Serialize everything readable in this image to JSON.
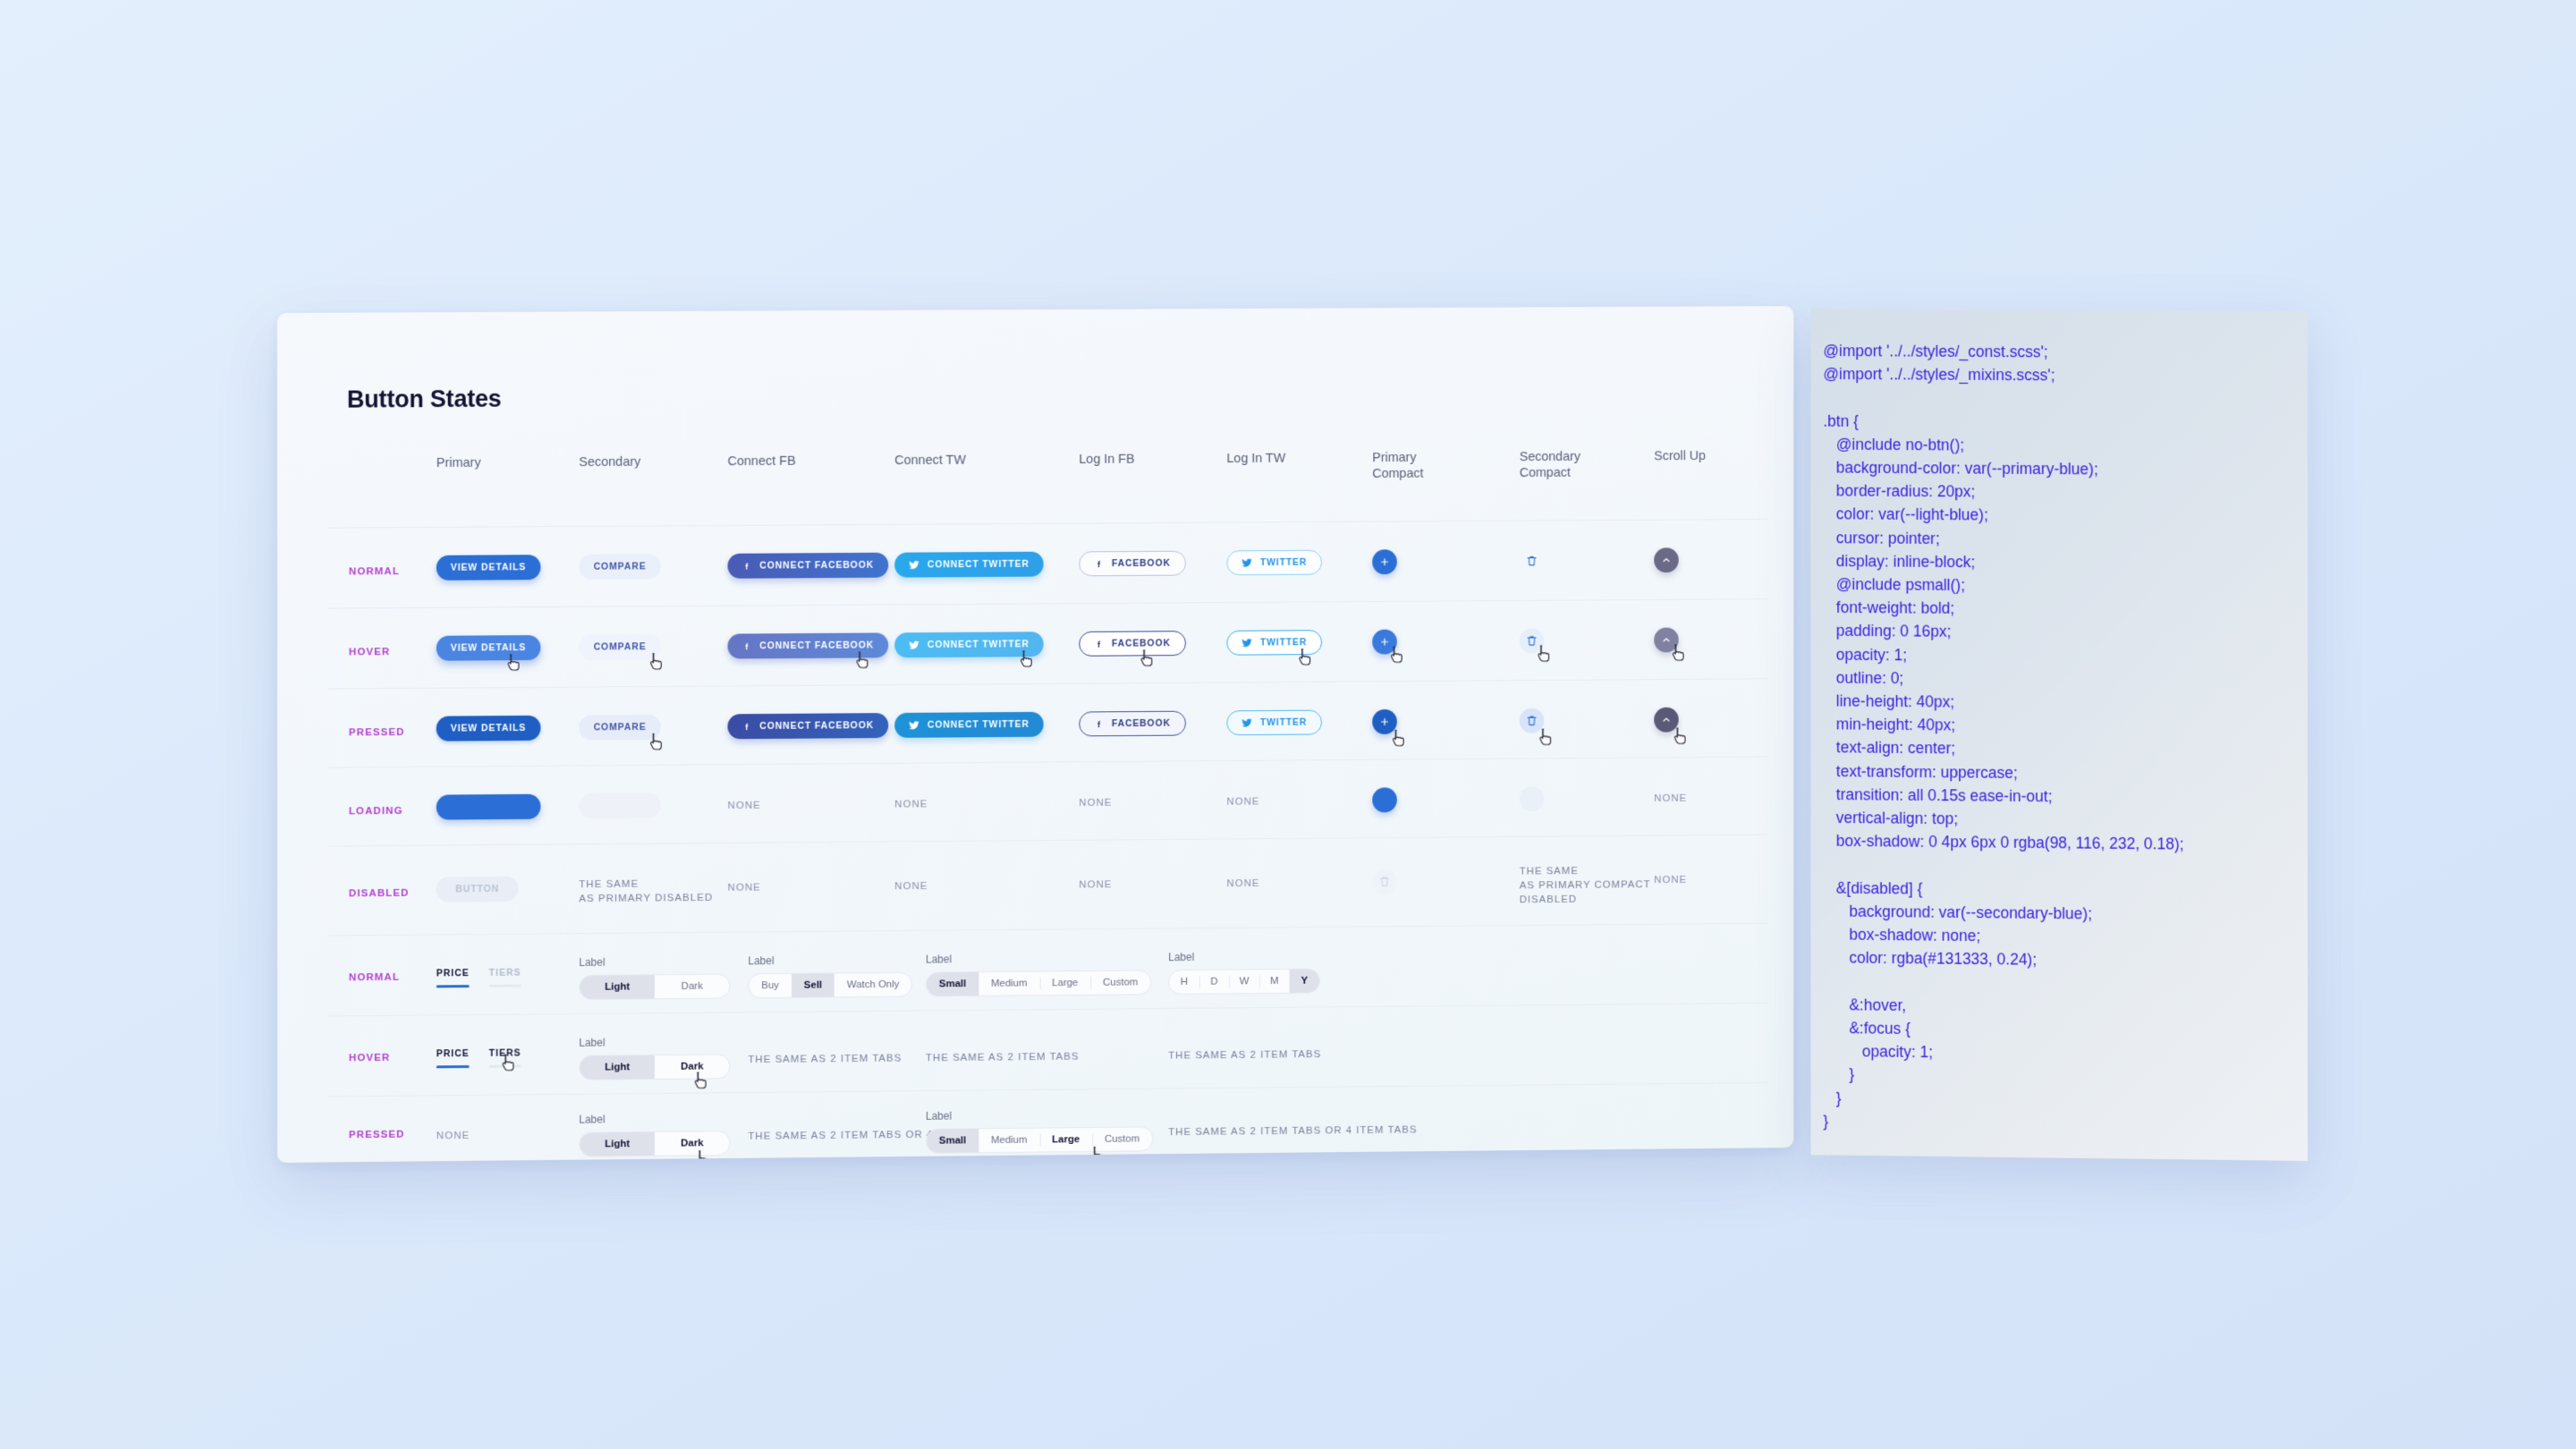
{
  "board": {
    "title": "Button States",
    "column_headers": [
      "Primary",
      "Secondary",
      "Connect FB",
      "Connect TW",
      "Log In FB",
      "Log In TW",
      "Primary\nCompact",
      "Secondary\nCompact",
      "Scroll Up"
    ],
    "state_rows": [
      "Normal",
      "Hover",
      "Pressed",
      "Loading",
      "Disabled"
    ],
    "tab_rows": [
      "Normal",
      "Hover",
      "Pressed"
    ],
    "none_label": "None",
    "buttons": {
      "primary_label": "View Details",
      "primary_disabled_label": "Button",
      "secondary_label": "Compare",
      "connect_fb_label": "Connect Facebook",
      "connect_tw_label": "Connect Twitter",
      "login_fb_label": "Facebook",
      "login_tw_label": "Twitter",
      "compact_plus": "+",
      "scroll_up_glyph": "chevron-up"
    },
    "notes": {
      "same_as_primary_disabled": "The same\nas primary disabled",
      "same_as_primary_compact_disabled": "The same\nas primary compact\ndisabled",
      "same_as_2_item_tabs": "The same as 2 item tabs",
      "same_as_2_or_4_item_tabs": "The same as 2 item tabs or 4 item tabs"
    },
    "tabs": {
      "underline": {
        "items": [
          "Price",
          "Tiers"
        ],
        "active_index": 0,
        "hover_index": 1
      },
      "seg_label": "Label",
      "two_item": {
        "items": [
          "Light",
          "Dark"
        ],
        "active_index": 0,
        "hover_index": 1
      },
      "three_item": {
        "items": [
          "Buy",
          "Sell",
          "Watch Only"
        ],
        "active_index": 1
      },
      "four_item": {
        "items": [
          "Small",
          "Medium",
          "Large",
          "Custom"
        ],
        "active_index": 0,
        "hover_index": 2
      },
      "five_item": {
        "items": [
          "H",
          "D",
          "W",
          "M",
          "Y"
        ],
        "active_index": 4
      }
    },
    "colors": {
      "page_background": "#dce9fb",
      "panel_background": "#f3f8fb",
      "primary_blue": "#2b6fd6",
      "secondary_blue": "#eaf0fa",
      "facebook_blue": "#4a5bb5",
      "twitter_blue": "#29a8ec",
      "row_label_magenta": "#b43fd0",
      "scroll_up_gray": "#6a6a86",
      "text_dark": "#131333",
      "muted_text": "#7b819c"
    }
  },
  "code_panel": {
    "language": "scss",
    "text": "@import '../../styles/_const.scss';\n@import '../../styles/_mixins.scss';\n\n.btn {\n   @include no-btn();\n   background-color: var(--primary-blue);\n   border-radius: 20px;\n   color: var(--light-blue);\n   cursor: pointer;\n   display: inline-block;\n   @include psmall();\n   font-weight: bold;\n   padding: 0 16px;\n   opacity: 1;\n   outline: 0;\n   line-height: 40px;\n   min-height: 40px;\n   text-align: center;\n   text-transform: uppercase;\n   transition: all 0.15s ease-in-out;\n   vertical-align: top;\n   box-shadow: 0 4px 6px 0 rgba(98, 116, 232, 0.18);\n\n   &[disabled] {\n      background: var(--secondary-blue);\n      box-shadow: none;\n      color: rgba(#131333, 0.24);\n\n      &:hover,\n      &:focus {\n         opacity: 1;\n      }\n   }\n}",
    "code_color": "#3a22e0"
  }
}
